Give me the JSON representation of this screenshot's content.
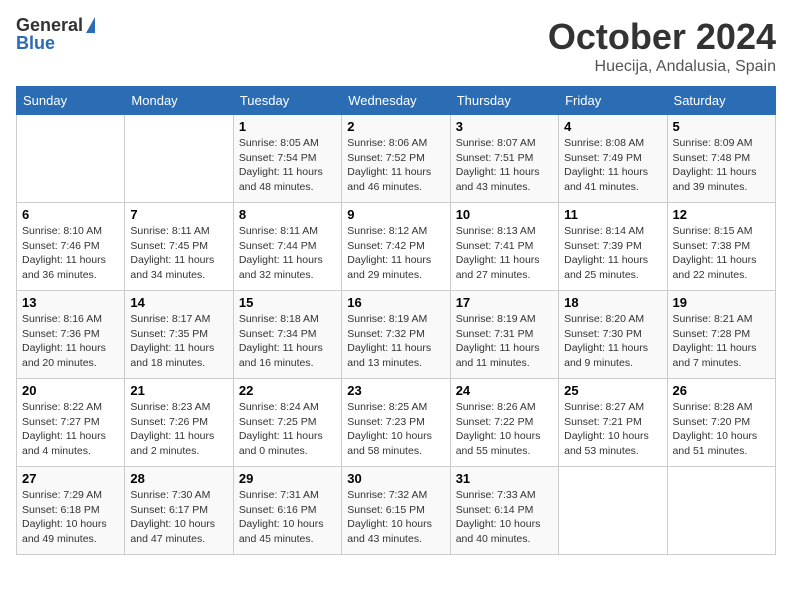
{
  "header": {
    "logo_general": "General",
    "logo_blue": "Blue",
    "month_title": "October 2024",
    "location": "Huecija, Andalusia, Spain"
  },
  "weekdays": [
    "Sunday",
    "Monday",
    "Tuesday",
    "Wednesday",
    "Thursday",
    "Friday",
    "Saturday"
  ],
  "weeks": [
    [
      {
        "day": "",
        "info": ""
      },
      {
        "day": "",
        "info": ""
      },
      {
        "day": "1",
        "info": "Sunrise: 8:05 AM\nSunset: 7:54 PM\nDaylight: 11 hours and 48 minutes."
      },
      {
        "day": "2",
        "info": "Sunrise: 8:06 AM\nSunset: 7:52 PM\nDaylight: 11 hours and 46 minutes."
      },
      {
        "day": "3",
        "info": "Sunrise: 8:07 AM\nSunset: 7:51 PM\nDaylight: 11 hours and 43 minutes."
      },
      {
        "day": "4",
        "info": "Sunrise: 8:08 AM\nSunset: 7:49 PM\nDaylight: 11 hours and 41 minutes."
      },
      {
        "day": "5",
        "info": "Sunrise: 8:09 AM\nSunset: 7:48 PM\nDaylight: 11 hours and 39 minutes."
      }
    ],
    [
      {
        "day": "6",
        "info": "Sunrise: 8:10 AM\nSunset: 7:46 PM\nDaylight: 11 hours and 36 minutes."
      },
      {
        "day": "7",
        "info": "Sunrise: 8:11 AM\nSunset: 7:45 PM\nDaylight: 11 hours and 34 minutes."
      },
      {
        "day": "8",
        "info": "Sunrise: 8:11 AM\nSunset: 7:44 PM\nDaylight: 11 hours and 32 minutes."
      },
      {
        "day": "9",
        "info": "Sunrise: 8:12 AM\nSunset: 7:42 PM\nDaylight: 11 hours and 29 minutes."
      },
      {
        "day": "10",
        "info": "Sunrise: 8:13 AM\nSunset: 7:41 PM\nDaylight: 11 hours and 27 minutes."
      },
      {
        "day": "11",
        "info": "Sunrise: 8:14 AM\nSunset: 7:39 PM\nDaylight: 11 hours and 25 minutes."
      },
      {
        "day": "12",
        "info": "Sunrise: 8:15 AM\nSunset: 7:38 PM\nDaylight: 11 hours and 22 minutes."
      }
    ],
    [
      {
        "day": "13",
        "info": "Sunrise: 8:16 AM\nSunset: 7:36 PM\nDaylight: 11 hours and 20 minutes."
      },
      {
        "day": "14",
        "info": "Sunrise: 8:17 AM\nSunset: 7:35 PM\nDaylight: 11 hours and 18 minutes."
      },
      {
        "day": "15",
        "info": "Sunrise: 8:18 AM\nSunset: 7:34 PM\nDaylight: 11 hours and 16 minutes."
      },
      {
        "day": "16",
        "info": "Sunrise: 8:19 AM\nSunset: 7:32 PM\nDaylight: 11 hours and 13 minutes."
      },
      {
        "day": "17",
        "info": "Sunrise: 8:19 AM\nSunset: 7:31 PM\nDaylight: 11 hours and 11 minutes."
      },
      {
        "day": "18",
        "info": "Sunrise: 8:20 AM\nSunset: 7:30 PM\nDaylight: 11 hours and 9 minutes."
      },
      {
        "day": "19",
        "info": "Sunrise: 8:21 AM\nSunset: 7:28 PM\nDaylight: 11 hours and 7 minutes."
      }
    ],
    [
      {
        "day": "20",
        "info": "Sunrise: 8:22 AM\nSunset: 7:27 PM\nDaylight: 11 hours and 4 minutes."
      },
      {
        "day": "21",
        "info": "Sunrise: 8:23 AM\nSunset: 7:26 PM\nDaylight: 11 hours and 2 minutes."
      },
      {
        "day": "22",
        "info": "Sunrise: 8:24 AM\nSunset: 7:25 PM\nDaylight: 11 hours and 0 minutes."
      },
      {
        "day": "23",
        "info": "Sunrise: 8:25 AM\nSunset: 7:23 PM\nDaylight: 10 hours and 58 minutes."
      },
      {
        "day": "24",
        "info": "Sunrise: 8:26 AM\nSunset: 7:22 PM\nDaylight: 10 hours and 55 minutes."
      },
      {
        "day": "25",
        "info": "Sunrise: 8:27 AM\nSunset: 7:21 PM\nDaylight: 10 hours and 53 minutes."
      },
      {
        "day": "26",
        "info": "Sunrise: 8:28 AM\nSunset: 7:20 PM\nDaylight: 10 hours and 51 minutes."
      }
    ],
    [
      {
        "day": "27",
        "info": "Sunrise: 7:29 AM\nSunset: 6:18 PM\nDaylight: 10 hours and 49 minutes."
      },
      {
        "day": "28",
        "info": "Sunrise: 7:30 AM\nSunset: 6:17 PM\nDaylight: 10 hours and 47 minutes."
      },
      {
        "day": "29",
        "info": "Sunrise: 7:31 AM\nSunset: 6:16 PM\nDaylight: 10 hours and 45 minutes."
      },
      {
        "day": "30",
        "info": "Sunrise: 7:32 AM\nSunset: 6:15 PM\nDaylight: 10 hours and 43 minutes."
      },
      {
        "day": "31",
        "info": "Sunrise: 7:33 AM\nSunset: 6:14 PM\nDaylight: 10 hours and 40 minutes."
      },
      {
        "day": "",
        "info": ""
      },
      {
        "day": "",
        "info": ""
      }
    ]
  ]
}
